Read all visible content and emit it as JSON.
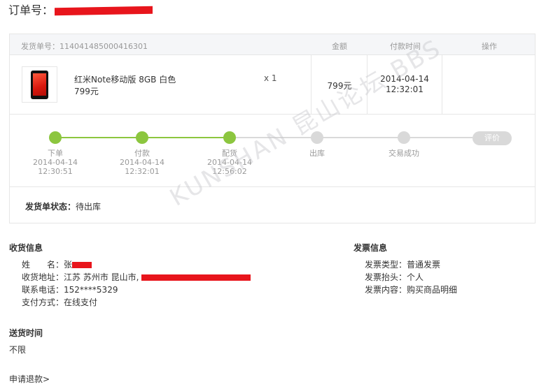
{
  "order": {
    "label": "订单号："
  },
  "card": {
    "shipment_no": "发货单号：114041485000416301",
    "col_amount": "金额",
    "col_paytime": "付款时间",
    "col_action": "操作"
  },
  "product": {
    "name": "红米Note移动版 8GB 白色",
    "price": "799元",
    "qty": "x 1",
    "amount": "799元",
    "pay_date": "2014-04-14",
    "pay_time": "12:32:01"
  },
  "progress": {
    "steps": [
      {
        "label": "下单",
        "date": "2014-04-14",
        "time": "12:30:51",
        "done": true
      },
      {
        "label": "付款",
        "date": "2014-04-14",
        "time": "12:32:01",
        "done": true
      },
      {
        "label": "配货",
        "date": "2014-04-14",
        "time": "12:56:02",
        "done": true
      },
      {
        "label": "出库",
        "date": "",
        "time": "",
        "done": false
      },
      {
        "label": "交易成功",
        "date": "",
        "time": "",
        "done": false
      }
    ],
    "rate_label": "评价",
    "done_color": "#8cc63f",
    "todo_color": "#d9d9d9"
  },
  "ship_status": {
    "label": "发货单状态：",
    "value": "待出库"
  },
  "watermark": "KUNSHAN 昆山论坛 BBS",
  "receiver": {
    "title": "收货信息",
    "name_label": "姓　　名：",
    "name_value": "张",
    "addr_label": "收货地址：",
    "addr_value": "江苏 苏州市 昆山市,",
    "phone_label": "联系电话：",
    "phone_value": "152****5329",
    "pay_label": "支付方式：",
    "pay_value": "在线支付"
  },
  "invoice": {
    "title": "发票信息",
    "type_label": "发票类型：",
    "type_value": "普通发票",
    "head_label": "发票抬头：",
    "head_value": "个人",
    "content_label": "发票内容：",
    "content_value": "购买商品明细"
  },
  "delivery": {
    "title": "送货时间",
    "value": "不限"
  },
  "refund_link": "申请退款>"
}
